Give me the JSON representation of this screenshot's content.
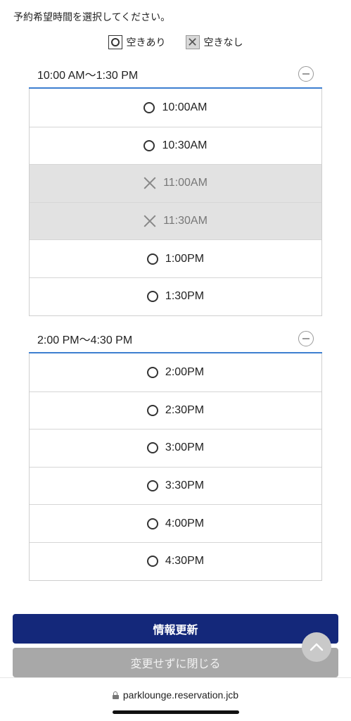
{
  "instruction": "予約希望時間を選択してください。",
  "legend": {
    "available_label": "空きあり",
    "full_label": "空きなし"
  },
  "sections": [
    {
      "title": "10:00 AM〜1:30 PM",
      "slots": [
        {
          "time": "10:00AM",
          "status": "available"
        },
        {
          "time": "10:30AM",
          "status": "available"
        },
        {
          "time": "11:00AM",
          "status": "full"
        },
        {
          "time": "11:30AM",
          "status": "full"
        },
        {
          "time": "1:00PM",
          "status": "available"
        },
        {
          "time": "1:30PM",
          "status": "available"
        }
      ]
    },
    {
      "title": "2:00 PM〜4:30 PM",
      "slots": [
        {
          "time": "2:00PM",
          "status": "available"
        },
        {
          "time": "2:30PM",
          "status": "available"
        },
        {
          "time": "3:00PM",
          "status": "available"
        },
        {
          "time": "3:30PM",
          "status": "available"
        },
        {
          "time": "4:00PM",
          "status": "available"
        },
        {
          "time": "4:30PM",
          "status": "available"
        }
      ]
    }
  ],
  "buttons": {
    "update_label": "情報更新",
    "close_label": "変更せずに閉じる"
  },
  "browser": {
    "url": "parklounge.reservation.jcb"
  },
  "colors": {
    "primary": "#14287a",
    "accent_line": "#3d7fd0",
    "full_slot_bg": "#e2e2e2",
    "secondary_button": "#a8a8a8"
  },
  "icons": {
    "available": "circle-icon",
    "full": "cross-icon",
    "collapse": "minus-circle-icon",
    "scroll_top": "chevron-up-icon",
    "lock": "lock-icon"
  }
}
